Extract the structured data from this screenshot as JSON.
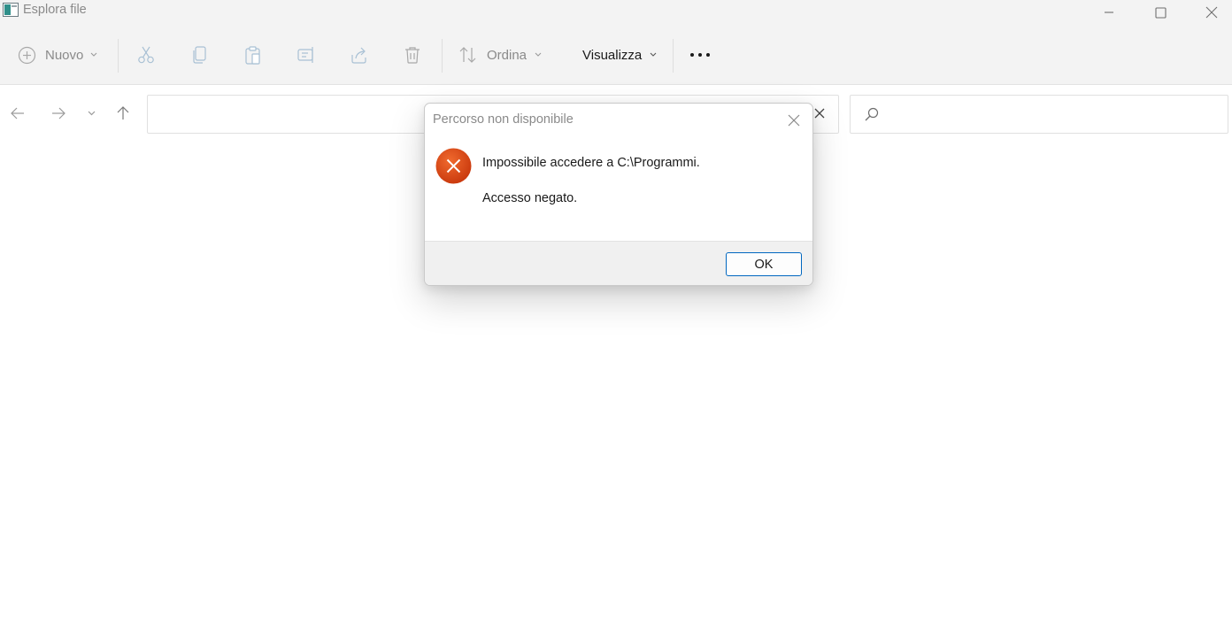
{
  "window": {
    "title": "Esplora file"
  },
  "commandbar": {
    "new_label": "Nuovo",
    "sort_label": "Ordina",
    "view_label": "Visualizza"
  },
  "address": {
    "value": "",
    "search_value": ""
  },
  "dialog": {
    "title": "Percorso non disponibile",
    "message": "Impossibile accedere a C:\\Programmi.",
    "detail": "Accesso negato.",
    "ok_label": "OK"
  },
  "colors": {
    "error_red": "#e04a18",
    "accent": "#0067c0",
    "chrome_bg": "#f3f3f3"
  },
  "icons": [
    "app-icon",
    "minimize-icon",
    "maximize-icon",
    "close-icon",
    "plus-circle-icon",
    "chevron-down-icon",
    "cut-icon",
    "copy-icon",
    "paste-icon",
    "rename-icon",
    "share-icon",
    "delete-icon",
    "sort-icon",
    "more-icon",
    "back-arrow-icon",
    "forward-arrow-icon",
    "recent-chevron-icon",
    "up-arrow-icon",
    "search-icon",
    "error-icon"
  ]
}
